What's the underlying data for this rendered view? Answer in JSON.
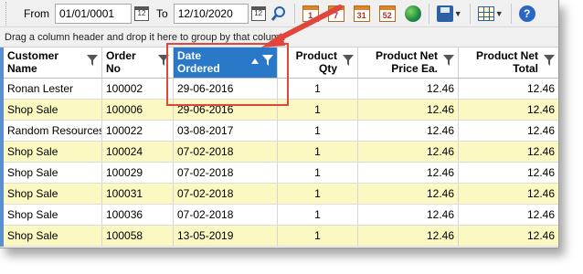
{
  "toolbar": {
    "from_label": "From",
    "from_value": "01/01/0001",
    "to_label": "To",
    "to_value": "12/10/2020",
    "day_icons": [
      "1",
      "7",
      "31",
      "52"
    ]
  },
  "group_panel_text": "Drag a column header and drop it here to group by that column",
  "colors": {
    "row_alt": "#fbf8c2",
    "header_selected": "#2a78c8",
    "highlight": "#e0463c"
  },
  "columns": [
    {
      "line1": "Customer",
      "line2": "Name"
    },
    {
      "line1": "Order",
      "line2": "No"
    },
    {
      "line1": "Date",
      "line2": "Ordered"
    },
    {
      "line1": "Product",
      "line2": "Qty"
    },
    {
      "line1": "Product Net",
      "line2": "Price Ea."
    },
    {
      "line1": "Product Net",
      "line2": "Total"
    }
  ],
  "rows": [
    {
      "customer": "Ronan Lester",
      "order": "100002",
      "date": "29-06-2016",
      "qty": "1",
      "price": "12.46",
      "total": "12.46"
    },
    {
      "customer": "Shop Sale",
      "order": "100006",
      "date": "29-06-2016",
      "qty": "1",
      "price": "12.46",
      "total": "12.46"
    },
    {
      "customer": "Random Resources",
      "order": "100022",
      "date": "03-08-2017",
      "qty": "1",
      "price": "12.46",
      "total": "12.46"
    },
    {
      "customer": "Shop Sale",
      "order": "100024",
      "date": "07-02-2018",
      "qty": "1",
      "price": "12.46",
      "total": "12.46"
    },
    {
      "customer": "Shop Sale",
      "order": "100029",
      "date": "07-02-2018",
      "qty": "1",
      "price": "12.46",
      "total": "12.46"
    },
    {
      "customer": "Shop Sale",
      "order": "100031",
      "date": "07-02-2018",
      "qty": "1",
      "price": "12.46",
      "total": "12.46"
    },
    {
      "customer": "Shop Sale",
      "order": "100036",
      "date": "07-02-2018",
      "qty": "1",
      "price": "12.46",
      "total": "12.46"
    },
    {
      "customer": "Shop Sale",
      "order": "100058",
      "date": "13-05-2019",
      "qty": "1",
      "price": "12.46",
      "total": "12.46"
    }
  ]
}
